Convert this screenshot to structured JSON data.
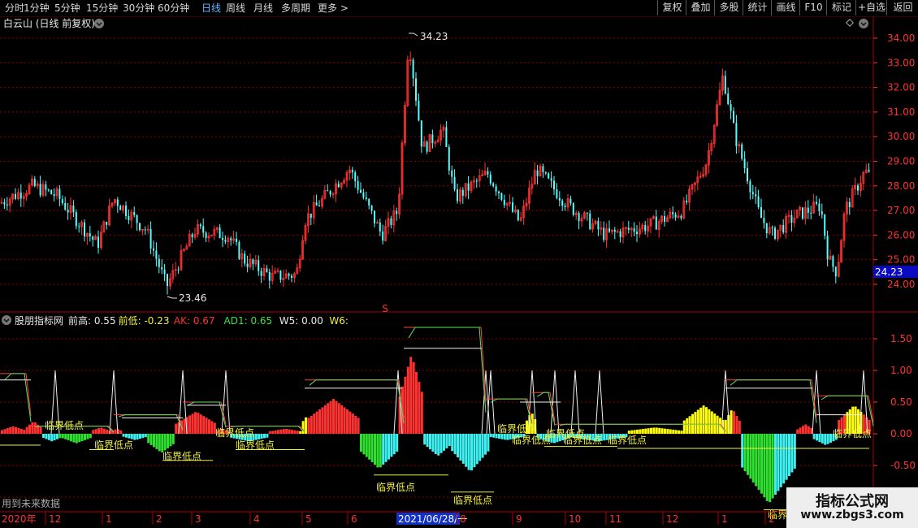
{
  "toolbar": {
    "periods": [
      "分时",
      "1分钟",
      "5分钟",
      "15分钟",
      "30分钟",
      "60分钟",
      "日线",
      "周线",
      "月线",
      "多周期",
      "更多 >"
    ],
    "active_period": "日线",
    "right_buttons": [
      "复权",
      "叠加",
      "多股",
      "统计",
      "画线",
      "F10",
      "标记",
      "+自选",
      "返回"
    ]
  },
  "main_panel": {
    "stock_title": "白云山 (日线 前复权)",
    "high_label": "34.23",
    "low_label": "23.46",
    "current_price": "24.23",
    "y_ticks": [
      "34.00",
      "33.00",
      "32.00",
      "31.00",
      "30.00",
      "29.00",
      "28.00",
      "27.00",
      "26.00",
      "25.00",
      "24.00"
    ],
    "s_marker": "S"
  },
  "indicator_panel": {
    "name": "股朋指标网",
    "fields": [
      {
        "label": "前高: ",
        "value": "0.55",
        "color": "#e8e8e8"
      },
      {
        "label": "前低: ",
        "value": "-0.23",
        "color": "#f0f040"
      },
      {
        "label": "AK: ",
        "value": "0.67",
        "color": "#ff3030"
      },
      {
        "label": "AD1: ",
        "value": "0.65",
        "color": "#40e040"
      },
      {
        "label": "W5: ",
        "value": "0.00",
        "color": "#e8e8e8"
      },
      {
        "label": "W6: ",
        "value": "",
        "color": "#f0f040"
      }
    ],
    "y_ticks": [
      "1.50",
      "1.00",
      "0.50",
      "0.00",
      "-0.50",
      "-1.00"
    ],
    "annotation_text": "临界低点",
    "future_data_note": "用到未来数据"
  },
  "date_axis": {
    "labels": [
      "2020年",
      "12",
      "1",
      "2",
      "3",
      "4",
      "5",
      "6",
      "2021/06/28/一",
      "8",
      "9",
      "10",
      "11",
      "12",
      "1",
      "2"
    ],
    "selected_label": "2021/06/28/一"
  },
  "watermark": {
    "line1": "指标公式网",
    "line2": "www.zbgs3.com"
  },
  "colors": {
    "up": "#ff3232",
    "down": "#54ffff",
    "cyan_fill": "#3ff0f0",
    "yellow_fill": "#ffff00",
    "green_fill": "#30e030",
    "grid": "#8b0000",
    "axis_text": "#ff3232"
  }
}
